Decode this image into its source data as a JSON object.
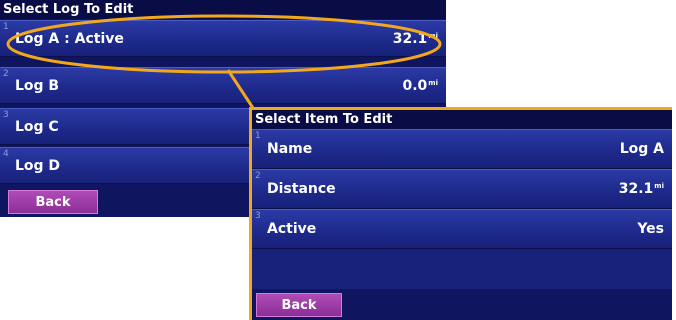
{
  "log_screen": {
    "title": "Select Log To Edit",
    "rows": [
      {
        "index": "1",
        "label": "Log A : Active",
        "value": "32.1",
        "unit": "mi"
      },
      {
        "index": "2",
        "label": "Log B",
        "value": "0.0",
        "unit": "mi"
      },
      {
        "index": "3",
        "label": "Log C",
        "value": "",
        "unit": ""
      },
      {
        "index": "4",
        "label": "Log D",
        "value": "",
        "unit": ""
      }
    ],
    "back_label": "Back"
  },
  "item_screen": {
    "title": "Select Item To Edit",
    "rows": [
      {
        "index": "1",
        "label": "Name",
        "value": "Log A",
        "unit": ""
      },
      {
        "index": "2",
        "label": "Distance",
        "value": "32.1",
        "unit": "mi"
      },
      {
        "index": "3",
        "label": "Active",
        "value": "Yes",
        "unit": ""
      }
    ],
    "back_label": "Back"
  },
  "colors": {
    "callout": "#f2a81c",
    "screen_bg": "#101560",
    "back_button": "#9b3aa6"
  }
}
